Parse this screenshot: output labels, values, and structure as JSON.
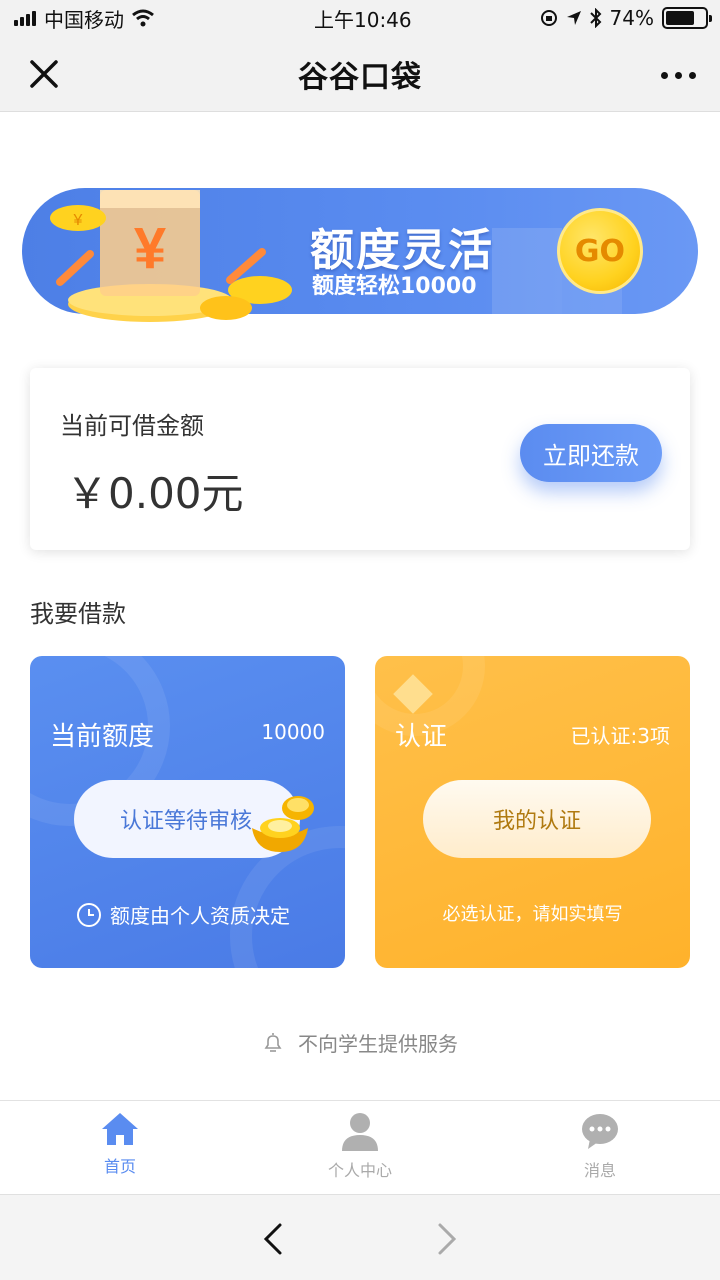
{
  "status_bar": {
    "carrier": "中国移动",
    "time": "上午10:46",
    "battery": "74%",
    "battery_level": 0.74
  },
  "nav": {
    "title": "谷谷口袋"
  },
  "banner": {
    "title": "额度灵活",
    "subtitle": "额度轻松10000",
    "go_label": "GO"
  },
  "loan_card": {
    "label": "当前可借金额",
    "amount": "￥0.00元",
    "repay_button": "立即还款"
  },
  "section": {
    "title": "我要借款"
  },
  "quota_card": {
    "title": "当前额度",
    "value": "10000",
    "button": "认证等待审核",
    "footer": "额度由个人资质决定"
  },
  "verify_card": {
    "title": "认证",
    "status": "已认证:3项",
    "button": "我的认证",
    "footer": "必选认证，请如实填写"
  },
  "notice": {
    "text": "不向学生提供服务"
  },
  "tabbar": {
    "items": [
      {
        "label": "首页",
        "icon": "home-icon",
        "active": true
      },
      {
        "label": "个人中心",
        "icon": "user-icon",
        "active": false
      },
      {
        "label": "消息",
        "icon": "message-icon",
        "active": false
      }
    ]
  },
  "colors": {
    "primary": "#5a8cf0",
    "accent_yellow": "#ffb22b",
    "text": "#333333"
  }
}
